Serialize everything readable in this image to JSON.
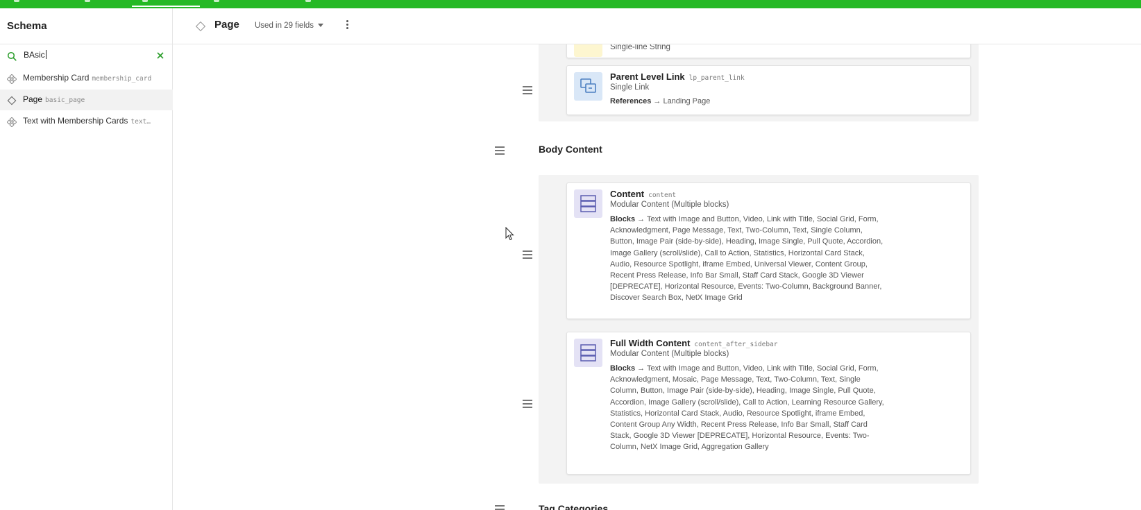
{
  "sidebar": {
    "title": "Schema",
    "search": {
      "value": "BAsic"
    },
    "items": [
      {
        "label": "Membership Card",
        "key": "membership_card",
        "active": false
      },
      {
        "label": "Page",
        "key": "basic_page",
        "active": true
      },
      {
        "label": "Text with Membership Cards",
        "key": "text…",
        "active": false
      }
    ]
  },
  "header": {
    "title": "Page",
    "used_in": "Used in 29 fields"
  },
  "fields": {
    "partial_type": "Single-line String",
    "parent_link": {
      "name": "Parent Level Link",
      "key": "lp_parent_link",
      "type": "Single Link",
      "refs_label": "References",
      "refs_value": "→ Landing Page"
    }
  },
  "body_section": {
    "title": "Body Content",
    "content": {
      "name": "Content",
      "key": "content",
      "type": "Modular Content (Multiple blocks)",
      "blocks_label": "Blocks",
      "blocks_value": "→ Text with Image and Button, Video, Link with Title, Social Grid, Form, Acknowledgment, Page Message, Text, Two-Column, Text, Single Column, Button, Image Pair (side-by-side), Heading, Image Single, Pull Quote, Accordion, Image Gallery (scroll/slide), Call to Action, Statistics, Horizontal Card Stack, Audio, Resource Spotlight, iframe Embed, Universal Viewer, Content Group, Recent Press Release, Info Bar Small, Staff Card Stack, Google 3D Viewer [DEPRECATE], Horizontal Resource, Events: Two-Column, Background Banner, Discover Search Box, NetX Image Grid"
    },
    "full_width": {
      "name": "Full Width Content",
      "key": "content_after_sidebar",
      "type": "Modular Content (Multiple blocks)",
      "blocks_label": "Blocks",
      "blocks_value": "→ Text with Image and Button, Video, Link with Title, Social Grid, Form, Acknowledgment, Mosaic, Page Message, Text, Two-Column, Text, Single Column, Button, Image Pair (side-by-side), Heading, Image Single, Pull Quote, Accordion, Image Gallery (scroll/slide), Call to Action, Learning Resource Gallery, Statistics, Horizontal Card Stack, Audio, Resource Spotlight, iframe Embed, Content Group Any Width, Recent Press Release, Info Bar Small, Staff Card Stack, Google 3D Viewer [DEPRECATE], Horizontal Resource, Events: Two-Column, NetX Image Grid, Aggregation Gallery"
    }
  },
  "next_section": {
    "title": "Tag Categories"
  },
  "colors": {
    "topbar": "#25b925",
    "accent_green": "#2a9d2a",
    "string_icon_bg": "#fdf6d0",
    "link_icon_bg": "#d9e7f7",
    "modular_icon_bg": "#e4e2f5"
  }
}
